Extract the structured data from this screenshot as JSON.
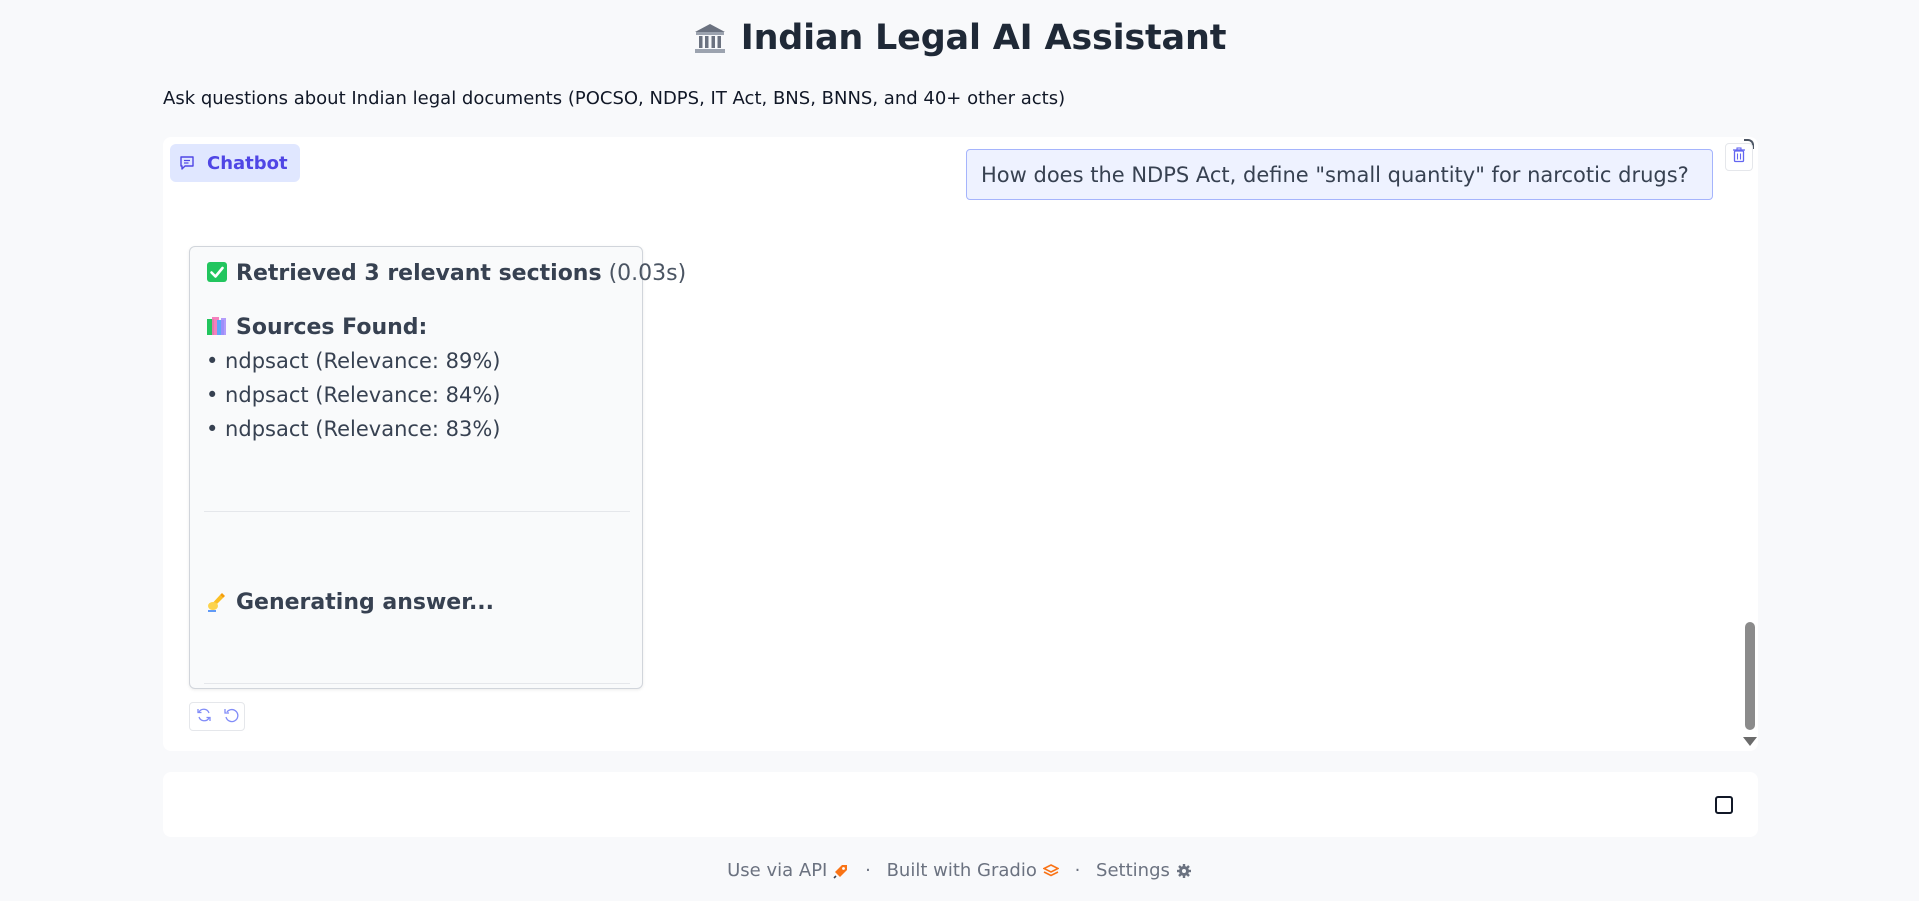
{
  "header": {
    "title": "Indian Legal AI Assistant",
    "title_icon": "classical-building-icon",
    "subtitle": "Ask questions about Indian legal documents (POCSO, NDPS, IT Act, BNS, BNNS, and 40+ other acts)"
  },
  "chatbot": {
    "label": "Chatbot",
    "label_icon": "chat-bubble-icon",
    "user_message": "How does the NDPS Act, define \"small quantity\" for narcotic drugs?",
    "bot_message": {
      "retrieved_bold": "Retrieved 3 relevant sections",
      "retrieved_time": "(0.03s)",
      "sources_heading": "Sources Found:",
      "sources": [
        "• ndpsact (Relevance: 89%)",
        "• ndpsact (Relevance: 84%)",
        "• ndpsact (Relevance: 83%)"
      ],
      "generating": "Generating answer..."
    },
    "icons": {
      "clear": "trash-icon",
      "retry": "retry-icon",
      "undo": "undo-icon",
      "check": "check-box-icon",
      "books": "books-icon",
      "writing": "writing-hand-icon"
    }
  },
  "input": {
    "stop_icon": "stop-square-icon"
  },
  "footer": {
    "api_label": "Use via API",
    "separator": "·",
    "built_label": "Built with Gradio",
    "settings_label": "Settings"
  },
  "colors": {
    "background": "#f8f9fb",
    "accent": "#4f46e5",
    "label_bg": "#e0e7ff",
    "user_bubble_bg": "#eef2ff",
    "user_bubble_border": "#a5b4fc",
    "check_green": "#22c55e",
    "gradio_orange": "#f97316"
  }
}
